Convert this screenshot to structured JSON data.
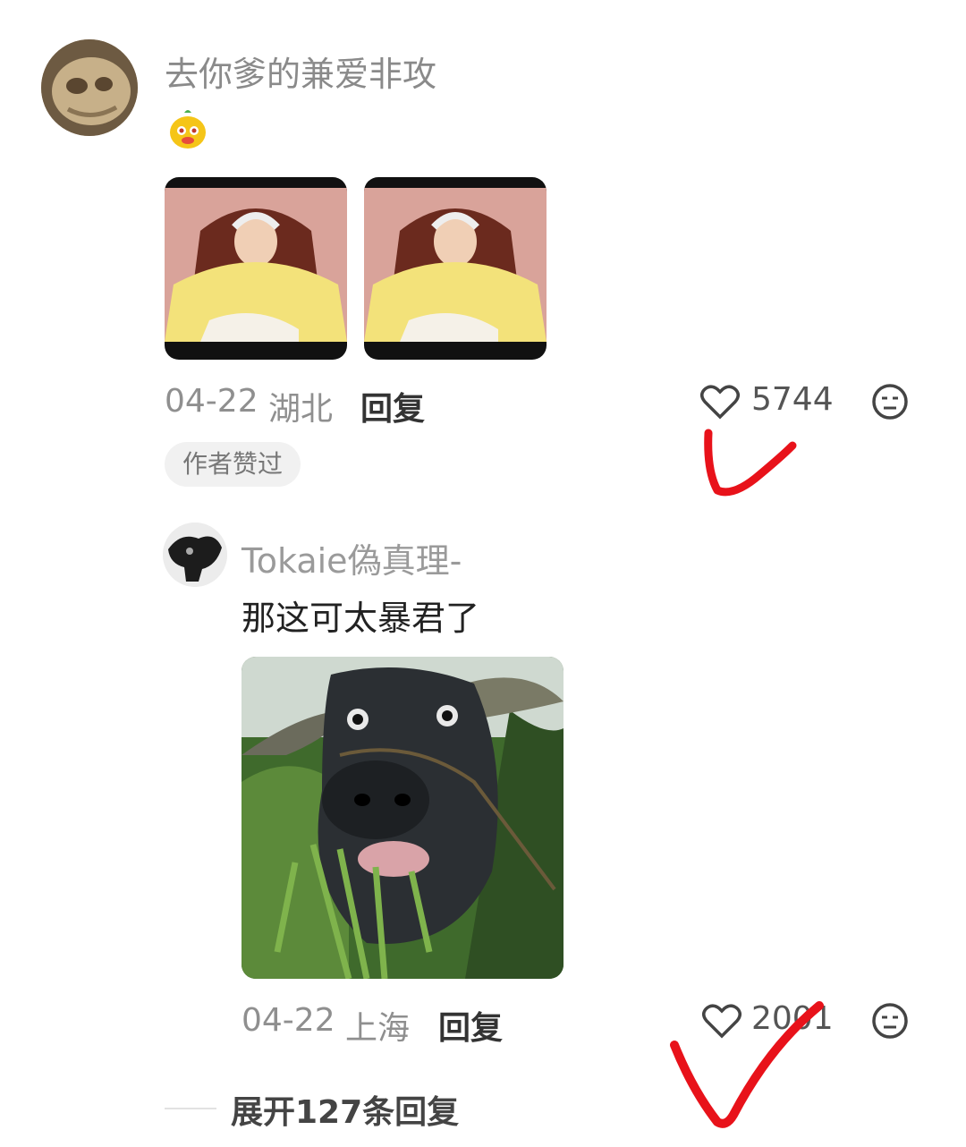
{
  "comment": {
    "username": "去你爹的兼爱非攻",
    "emoji_icon": "cartoon-bear-emoji",
    "images": [
      "photo-person-yellow-shirt",
      "photo-person-yellow-shirt"
    ],
    "date": "04-22",
    "location": "湖北",
    "reply_label": "回复",
    "likes": "5744",
    "author_badge": "作者赞过"
  },
  "reply": {
    "username": "Tokaie偽真理-",
    "text": "那这可太暴君了",
    "image": "photo-water-buffalo-eating-grass",
    "date": "04-22",
    "location": "上海",
    "reply_label": "回复",
    "likes": "2001"
  },
  "expand_label": "展开127条回复",
  "colors": {
    "annotation": "#e8121a",
    "muted": "#8a8a8a"
  }
}
